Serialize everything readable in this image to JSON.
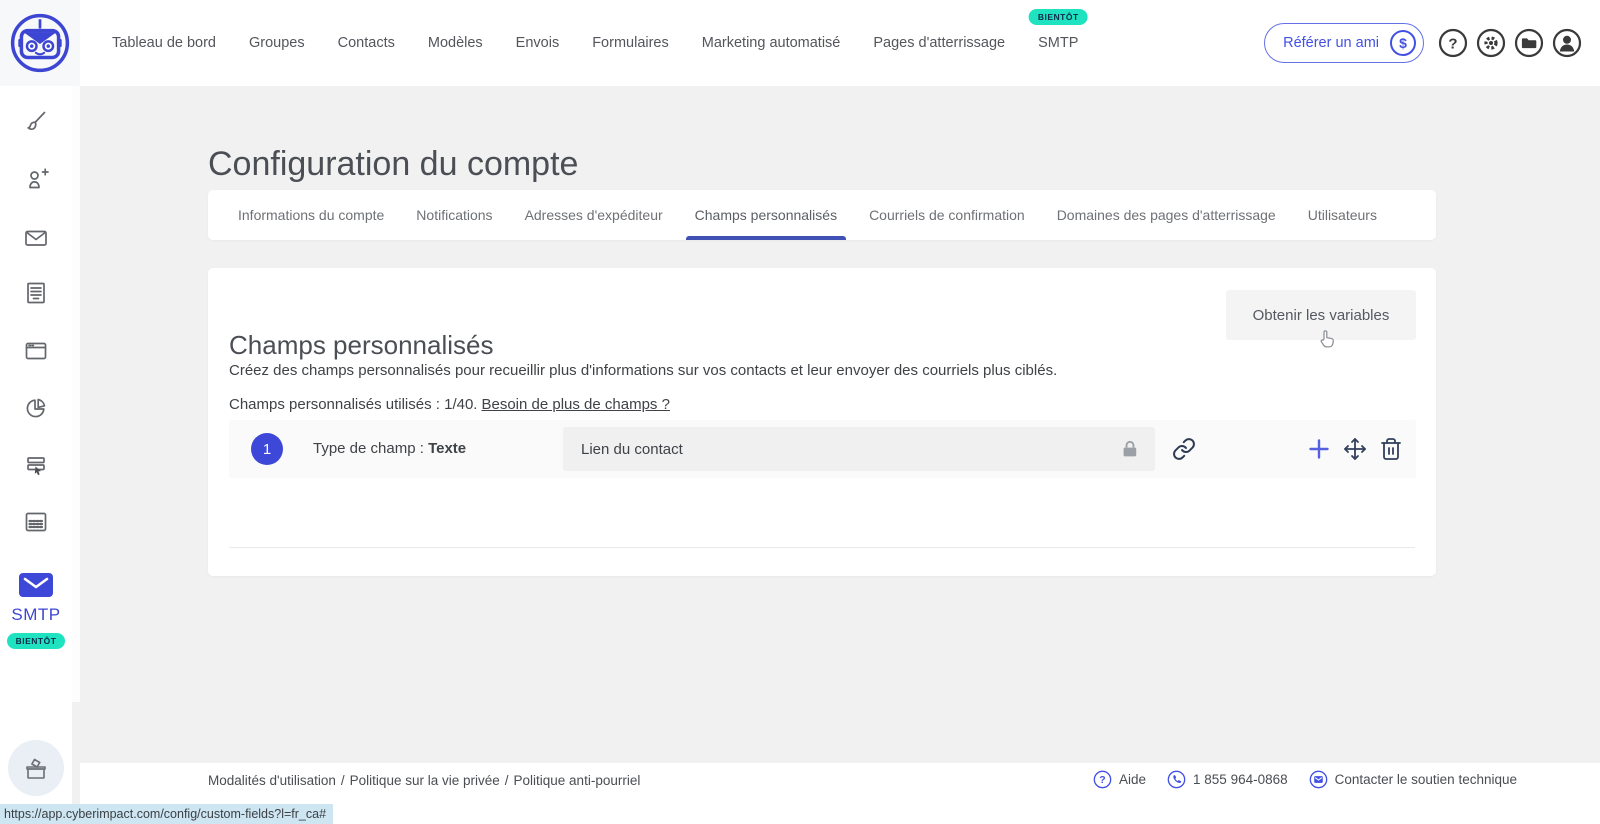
{
  "nav": {
    "items": [
      "Tableau de bord",
      "Groupes",
      "Contacts",
      "Modèles",
      "Envois",
      "Formulaires",
      "Marketing automatisé",
      "Pages d'atterrissage",
      "SMTP"
    ],
    "smtp_badge": "BIENTÔT",
    "refer_button": "Référer un ami",
    "dollar_symbol": "$"
  },
  "sidebar": {
    "smtp_label": "SMTP",
    "smtp_badge": "BIENTÔT"
  },
  "page": {
    "title": "Configuration du compte"
  },
  "tabs": {
    "items": [
      "Informations du compte",
      "Notifications",
      "Adresses d'expéditeur",
      "Champs personnalisés",
      "Courriels de confirmation",
      "Domaines des pages d'atterrissage",
      "Utilisateurs"
    ],
    "active_index": 3
  },
  "card": {
    "title": "Champs personnalisés",
    "description": "Créez des champs personnalisés pour recueillir plus d'informations sur vos contacts et leur envoyer des courriels plus ciblés.",
    "usage_text": "Champs personnalisés utilisés : 1/40.",
    "usage_link": "Besoin de plus de champs ?",
    "variables_button": "Obtenir les variables",
    "field": {
      "number": "1",
      "type_label": "Type de champ :",
      "type_value": "Texte",
      "value": "Lien du contact"
    }
  },
  "footer": {
    "links": [
      "Modalités d'utilisation",
      "Politique sur la vie privée",
      "Politique anti-pourriel"
    ],
    "separator": "/",
    "help": "Aide",
    "phone": "1 855 964-0868",
    "support": "Contacter le soutien technique"
  },
  "statusbar": {
    "url": "https://app.cyberimpact.com/config/custom-fields?l=fr_ca#"
  },
  "colors": {
    "primary": "#3d48d8",
    "accent_teal": "#1fe3c0",
    "active_tab_underline": "#3f51b5",
    "page_background": "#f1f1f2"
  }
}
